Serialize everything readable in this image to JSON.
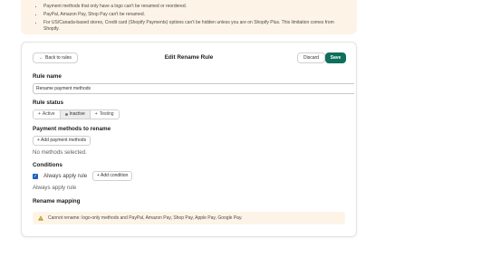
{
  "notice": {
    "items": [
      "Payment methods that only have a logo can't be renamed or reordered.",
      "PayPal, Amazon Pay, Shop Pay can't be renamed.",
      "For US/Canada-based stores, Credit card (Shopify Payments) options can't be hidden unless you are on Shopify Plus. This limitation comes from Shopify."
    ]
  },
  "editor": {
    "back_label": "Back to rules",
    "title": "Edit Rename Rule",
    "discard_label": "Discard",
    "save_label": "Save"
  },
  "rule_name": {
    "title": "Rule name",
    "value": "Rename payment methods"
  },
  "rule_status": {
    "title": "Rule status",
    "options": [
      {
        "label": "Active"
      },
      {
        "label": "Inactive",
        "selected": true
      },
      {
        "label": "Testing"
      }
    ]
  },
  "payment_methods": {
    "title": "Payment methods to rename",
    "add_label": "+ Add payment methods",
    "empty_text": "No methods selected."
  },
  "conditions": {
    "title": "Conditions",
    "always_apply_label": "Always apply rule",
    "always_apply_checked": true,
    "add_condition_label": "+ Add condition",
    "summary": "Always apply rule"
  },
  "rename_mapping": {
    "title": "Rename mapping",
    "warning": "Cannot rename: logo-only methods and PayPal, Amazon Pay, Shop Pay, Apple Pay, Google Pay."
  },
  "colors": {
    "accent": "#0e6f5c",
    "warning_bg": "#fdf4e7",
    "checkbox": "#1f5fbf"
  }
}
